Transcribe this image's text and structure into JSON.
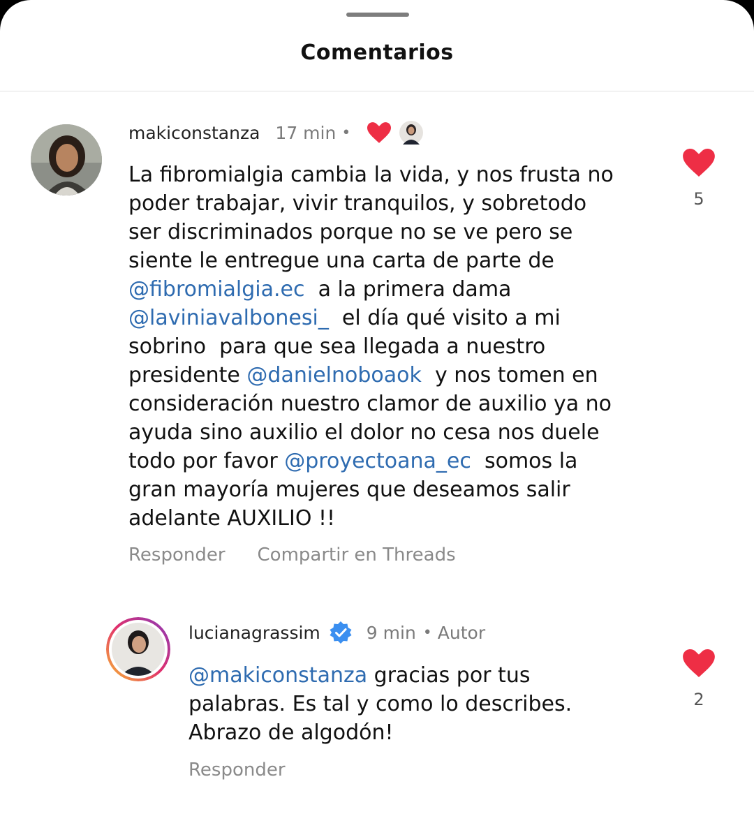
{
  "sheet": {
    "title": "Comentarios"
  },
  "comments": [
    {
      "username": "makiconstanza",
      "time": "17 min",
      "separator": "•",
      "text_parts": [
        {
          "t": "La fibromialgia cambia la vida, y nos frusta no\npoder trabajar, vivir tranquilos, y sobretodo\nser discriminados porque no se ve pero se\nsiente le entregue una carta de parte de\n",
          "m": false
        },
        {
          "t": "@fibromialgia.ec",
          "m": true
        },
        {
          "t": "  a la primera dama\n",
          "m": false
        },
        {
          "t": "@laviniavalbonesi_",
          "m": true
        },
        {
          "t": "  el día qué visito a mi\nsobrino  para que sea llegada a nuestro\npresidente ",
          "m": false
        },
        {
          "t": "@danielnoboaok",
          "m": true
        },
        {
          "t": "  y nos tomen en\nconsideración nuestro clamor de auxilio ya no\nayuda sino auxilio el dolor no cesa nos duele\ntodo por favor ",
          "m": false
        },
        {
          "t": "@proyectoana_ec",
          "m": true
        },
        {
          "t": "  somos la\ngran mayoría mujeres que deseamos salir\nadelante AUXILIO !!",
          "m": false
        }
      ],
      "reply_label": "Responder",
      "share_label": "Compartir en Threads",
      "like_count": "5"
    },
    {
      "username": "lucianagrassim",
      "time": "9 min",
      "separator": "•",
      "author_label": "Autor",
      "text_parts": [
        {
          "t": "@makiconstanza",
          "m": true
        },
        {
          "t": " gracias por tus\npalabras. Es tal y como lo describes.\nAbrazo de algodón!",
          "m": false
        }
      ],
      "reply_label": "Responder",
      "like_count": "2"
    }
  ],
  "colors": {
    "heart": "#ee2e45",
    "mention": "#2e6bb0",
    "verified": "#3b8ff0",
    "meta_gray": "#7a7a7a"
  },
  "icons": [
    "heart-icon",
    "verified-badge-icon",
    "creator-avatar-icon"
  ]
}
